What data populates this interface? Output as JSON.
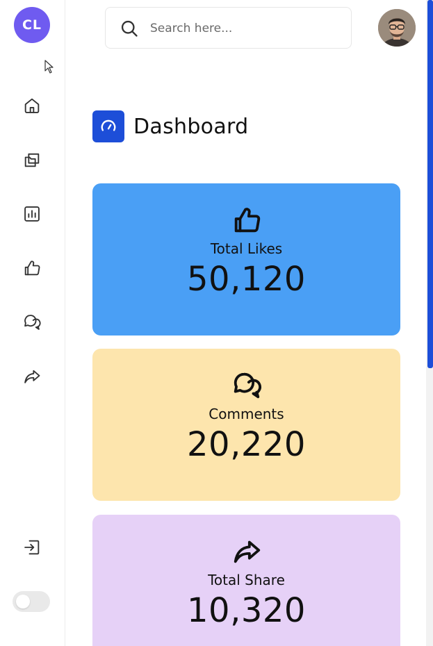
{
  "sidebar": {
    "logo_text": "CL",
    "nav": [
      {
        "name": "home",
        "icon": "home-icon"
      },
      {
        "name": "files",
        "icon": "folders-icon"
      },
      {
        "name": "analytics",
        "icon": "bar-chart-icon"
      },
      {
        "name": "likes",
        "icon": "thumbs-up-icon"
      },
      {
        "name": "comments",
        "icon": "chat-bubbles-icon"
      },
      {
        "name": "share",
        "icon": "share-arrow-icon"
      }
    ],
    "logout_icon": "logout-icon",
    "theme_toggle": {
      "state": "off"
    }
  },
  "search": {
    "placeholder": "Search here..."
  },
  "page": {
    "title": "Dashboard",
    "icon": "gauge-icon"
  },
  "cards": [
    {
      "label": "Total Likes",
      "value": "50,120",
      "icon": "thumbs-up-icon",
      "color": "#4a9ff5"
    },
    {
      "label": "Comments",
      "value": "20,220",
      "icon": "chat-bubbles-icon",
      "color": "#fde5ad"
    },
    {
      "label": "Total Share",
      "value": "10,320",
      "icon": "share-arrow-icon",
      "color": "#e6d1f7"
    }
  ],
  "colors": {
    "accent": "#1d4ed8",
    "logo_bg": "#6f5bf0"
  }
}
